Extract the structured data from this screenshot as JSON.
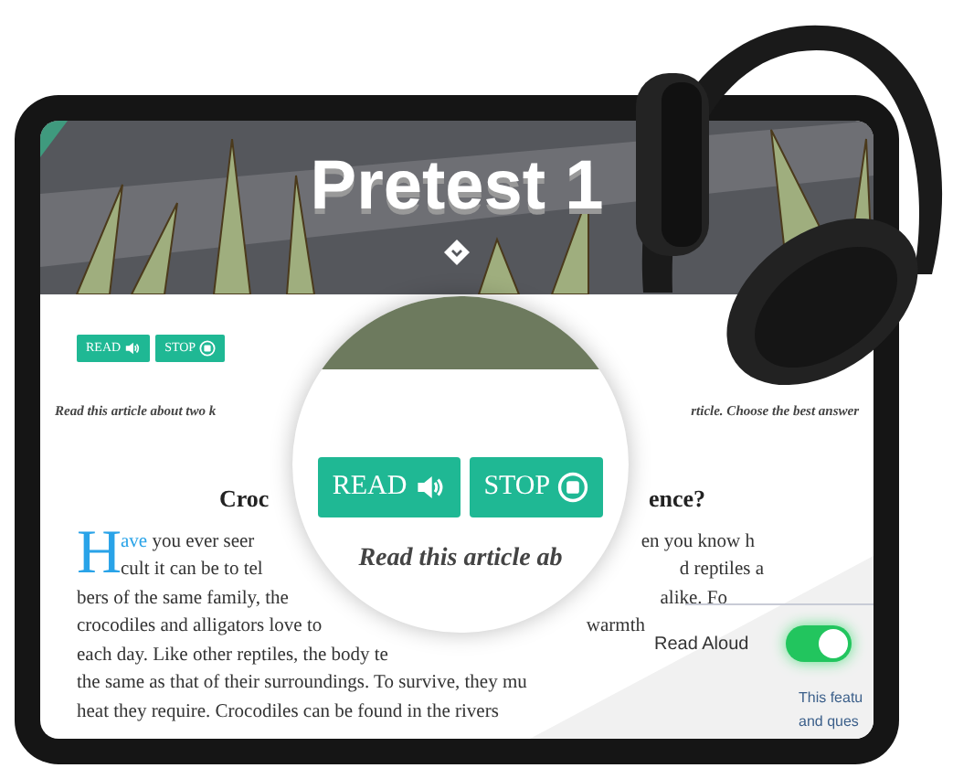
{
  "banner": {
    "title": "Pretest 1"
  },
  "toolbar": {
    "buttons": [
      {
        "label": "READ"
      },
      {
        "label": "STOP"
      }
    ]
  },
  "instruction": {
    "left": "Read this article about two k",
    "right": "rticle. Choose the best answer"
  },
  "article": {
    "title_left": "Croc",
    "title_right": "ence?",
    "drop_cap": "H",
    "lead_word": "ave",
    "lines": [
      {
        "left": "you ever seer",
        "right": "en you know h"
      },
      {
        "left": "cult it can be to tel",
        "right": "d reptiles a"
      },
      {
        "left": "bers of the same family, the",
        "right": "alike. Fo"
      },
      {
        "left": "crocodiles and alligators love to",
        "right": "warmth"
      },
      {
        "left": "each day. Like other reptiles, the body te"
      },
      {
        "left": "the same as that of their surroundings. To survive, they mu"
      },
      {
        "left": "heat they require. Crocodiles can be found in the rivers"
      }
    ]
  },
  "magnifier": {
    "buttons": [
      {
        "label": "READ"
      },
      {
        "label": "STOP"
      }
    ],
    "caption": "Read this article ab"
  },
  "settings_panel": {
    "label": "Read Aloud",
    "on": true,
    "description": [
      "This featu",
      "and ques"
    ]
  }
}
